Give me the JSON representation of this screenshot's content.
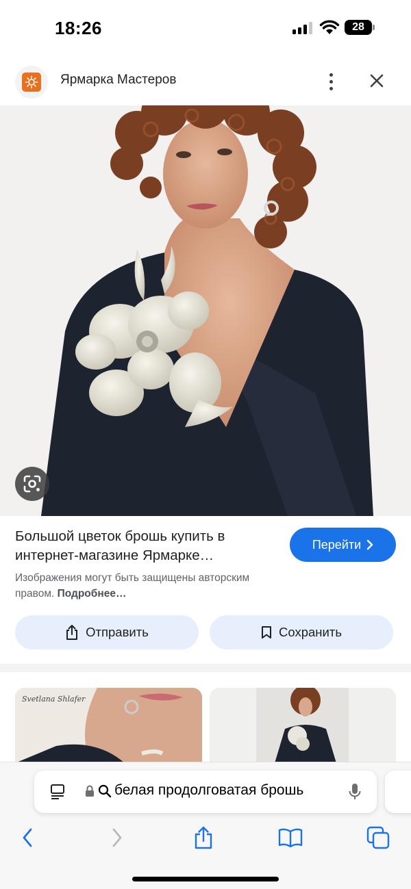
{
  "status_bar": {
    "time": "18:26",
    "battery": "28"
  },
  "source": {
    "name": "Ярмарка Мастеров",
    "favicon_icon": "yarmarka-logo-icon"
  },
  "result": {
    "title": "Большой цветок брошь купить в интернет-магазине Ярмарке…",
    "goto_label": "Перейти",
    "copyright_text": "Изображения могут быть защищены авторским правом.",
    "copyright_link": "Подробнее…"
  },
  "actions": {
    "share_label": "Отправить",
    "save_label": "Сохранить"
  },
  "thumbnails": {
    "first_watermark": "Svetlana Shlafer"
  },
  "browser": {
    "url_text": "белая продолговатая брошь"
  },
  "colors": {
    "accent": "#1a73e8",
    "chip_bg": "#e8effc",
    "favicon": "#e8701f"
  }
}
